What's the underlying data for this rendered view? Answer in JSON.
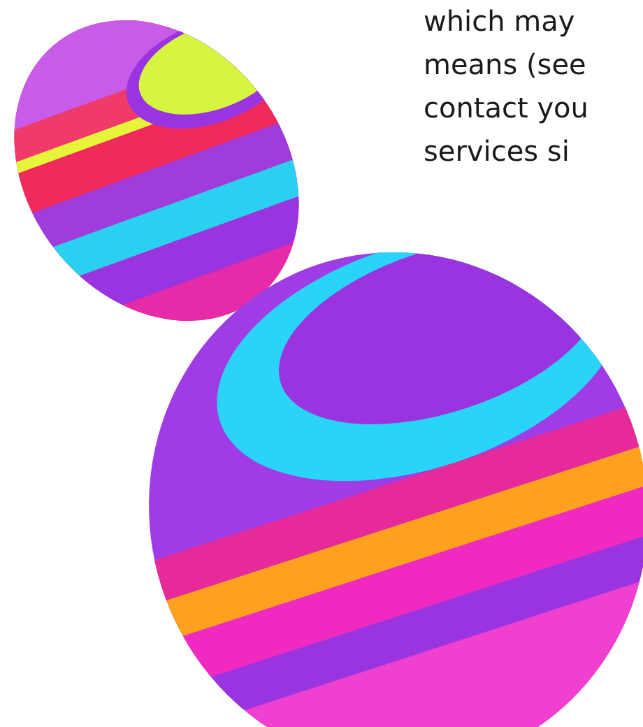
{
  "text_lines": [
    "which may",
    "means (see",
    "contact you",
    "services si"
  ]
}
